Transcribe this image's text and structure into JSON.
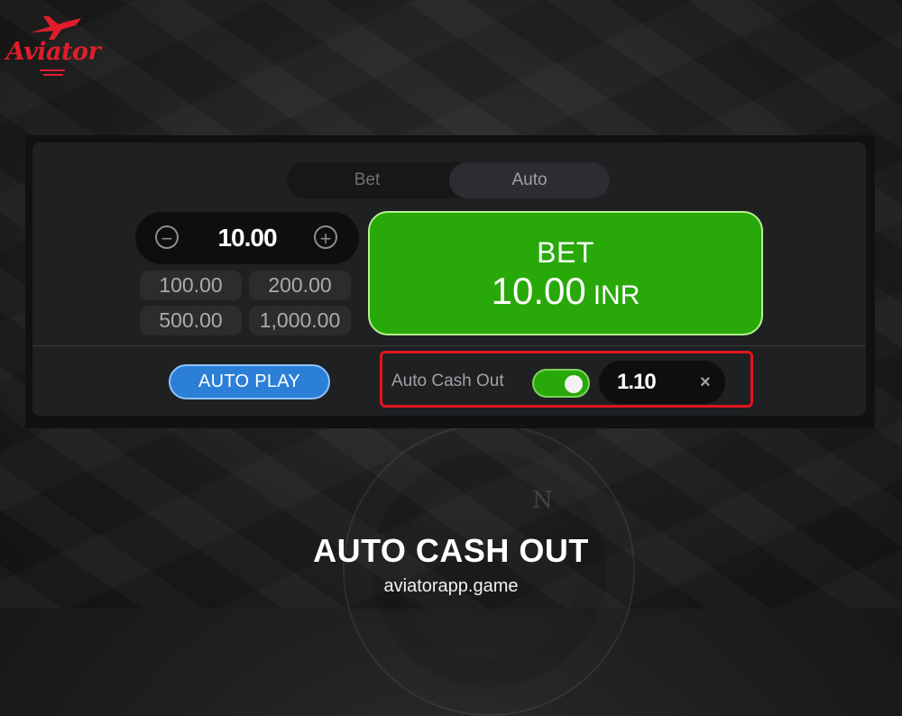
{
  "brand": {
    "logo_text": "Aviator",
    "accent_color": "#e11d2b"
  },
  "tabs": [
    {
      "label": "Bet",
      "active": false
    },
    {
      "label": "Auto",
      "active": true
    }
  ],
  "stake": {
    "value": "10.00",
    "minus_symbol": "−",
    "plus_symbol": "+",
    "presets": [
      "100.00",
      "200.00",
      "500.00",
      "1,000.00"
    ]
  },
  "bet_button": {
    "label": "BET",
    "amount": "10.00",
    "currency": "INR",
    "color": "#28a909"
  },
  "auto_play": {
    "label": "AUTO PLAY",
    "color": "#2c7fd6"
  },
  "auto_cash_out": {
    "label": "Auto Cash Out",
    "enabled": true,
    "value": "1.10",
    "clear_symbol": "×",
    "highlight_color": "#e2151f"
  },
  "caption": {
    "headline": "AUTO CASH OUT",
    "site": "aviatorapp.game"
  }
}
